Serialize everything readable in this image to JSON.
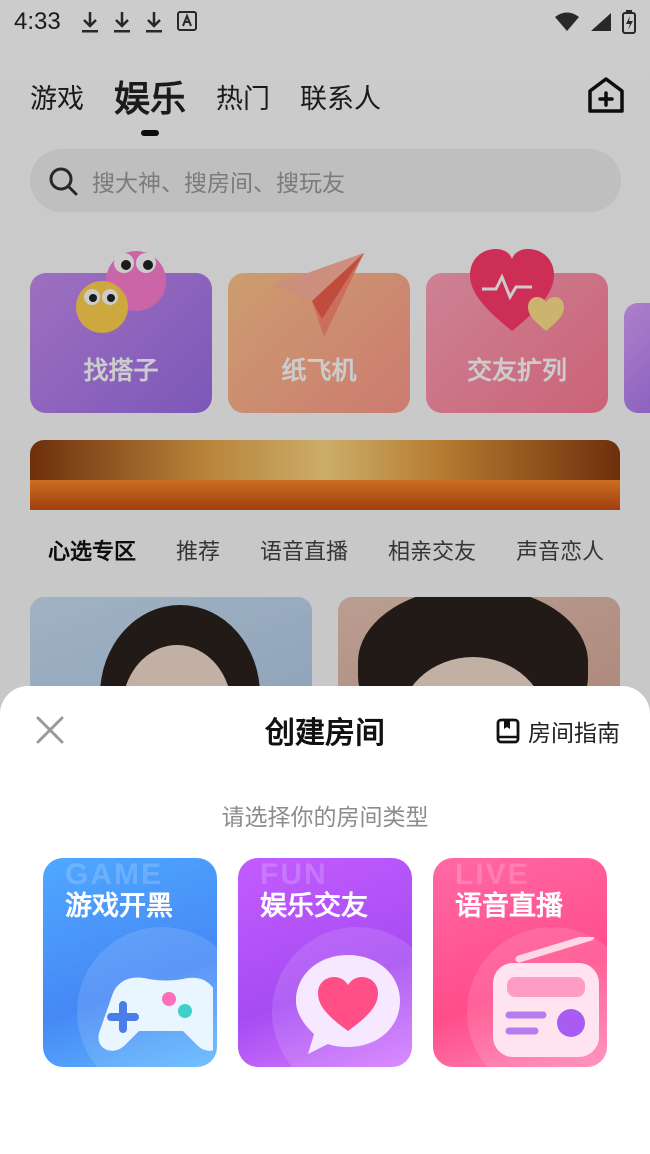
{
  "status_bar": {
    "time": "4:33"
  },
  "top_nav": {
    "tabs": [
      {
        "label": "游戏"
      },
      {
        "label": "娱乐"
      },
      {
        "label": "热门"
      },
      {
        "label": "联系人"
      }
    ],
    "active_tab": "娱乐"
  },
  "search": {
    "placeholder": "搜大神、搜房间、搜玩友"
  },
  "quick_entries": [
    {
      "label": "找搭子"
    },
    {
      "label": "纸飞机"
    },
    {
      "label": "交友扩列"
    }
  ],
  "category_tabs": [
    {
      "label": "心选专区"
    },
    {
      "label": "推荐"
    },
    {
      "label": "语音直播"
    },
    {
      "label": "相亲交友"
    },
    {
      "label": "声音恋人"
    }
  ],
  "sheet": {
    "title": "创建房间",
    "guide_label": "房间指南",
    "subtitle": "请选择你的房间类型",
    "room_types": [
      {
        "label": "游戏开黑",
        "ghost_text": "GAME",
        "icon": "gamepad-icon"
      },
      {
        "label": "娱乐交友",
        "ghost_text": "FUN",
        "icon": "heart-chat-icon"
      },
      {
        "label": "语音直播",
        "ghost_text": "LIVE",
        "icon": "radio-icon"
      }
    ]
  },
  "colors": {
    "game_card": "#4688f5",
    "fun_card": "#a64cf2",
    "live_card": "#ff4d8a",
    "tab_underline": "#ff6a92"
  }
}
